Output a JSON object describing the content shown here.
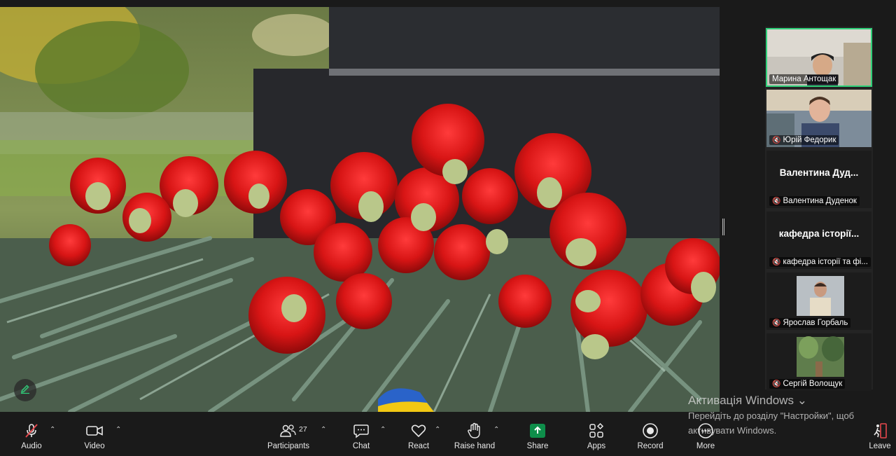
{
  "screen_share": {
    "description_icon": "annotate-pencil-icon"
  },
  "gallery": {
    "tiles": [
      {
        "name": "Марина Антощак",
        "type": "video",
        "active": true,
        "muted": false
      },
      {
        "name": "Юрій Федорик",
        "type": "video",
        "active": false,
        "muted": true
      },
      {
        "big_name": "Валентина  Дуд...",
        "name": "Валентина Дуденок",
        "type": "name",
        "muted": true
      },
      {
        "big_name": "кафедра історії...",
        "name": "кафедра історії та фі...",
        "type": "name",
        "muted": true
      },
      {
        "name": "Ярослав Горбаль",
        "type": "avatar",
        "muted": true
      },
      {
        "name": "Сергій Волощук",
        "type": "avatar",
        "muted": true
      }
    ]
  },
  "toolbar": {
    "audio": "Audio",
    "video": "Video",
    "participants": "Participants",
    "participants_count": "27",
    "chat": "Chat",
    "react": "React",
    "raise_hand": "Raise hand",
    "share": "Share",
    "apps": "Apps",
    "record": "Record",
    "more": "More",
    "leave": "Leave"
  },
  "watermark": {
    "title": "Активація Windows",
    "line1": "Перейдіть до розділу \"Настройки\", щоб",
    "line2": "активувати Windows."
  },
  "colors": {
    "accent_green": "#2fd17a",
    "share_green": "#0e8e4a",
    "leave_red": "#e5484d",
    "toolbar_bg": "#1a1a1a"
  }
}
